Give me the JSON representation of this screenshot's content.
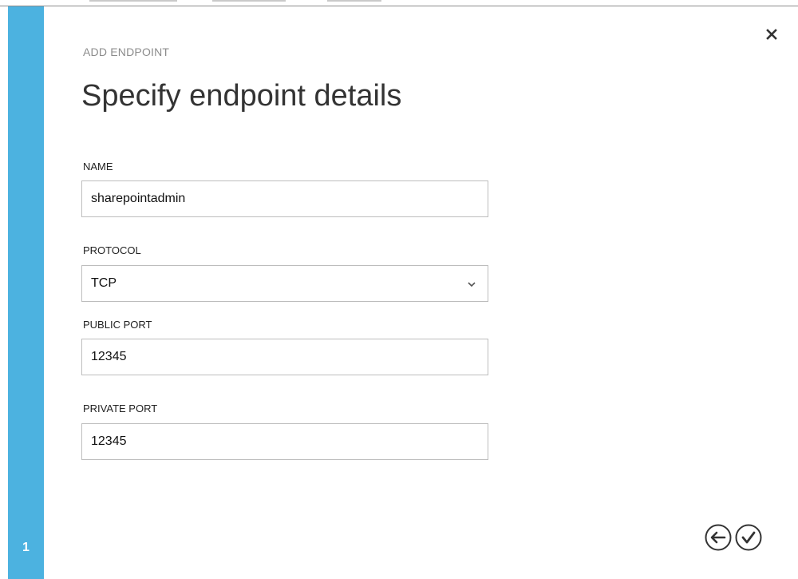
{
  "wizard": {
    "kicker": "ADD ENDPOINT",
    "title": "Specify endpoint details",
    "step": "1"
  },
  "form": {
    "name": {
      "label": "NAME",
      "value": "sharepointadmin"
    },
    "protocol": {
      "label": "PROTOCOL",
      "value": "TCP"
    },
    "public_port": {
      "label": "PUBLIC PORT",
      "value": "12345"
    },
    "private_port": {
      "label": "PRIVATE PORT",
      "value": "12345"
    }
  },
  "icons": {
    "close": "close-icon",
    "chevron": "chevron-down-icon",
    "back": "back-arrow-icon",
    "complete": "checkmark-icon"
  },
  "colors": {
    "rail": "#4cb2e0",
    "title": "#333333",
    "kicker": "#8c8c8c",
    "input_border": "#bdbdbd"
  }
}
